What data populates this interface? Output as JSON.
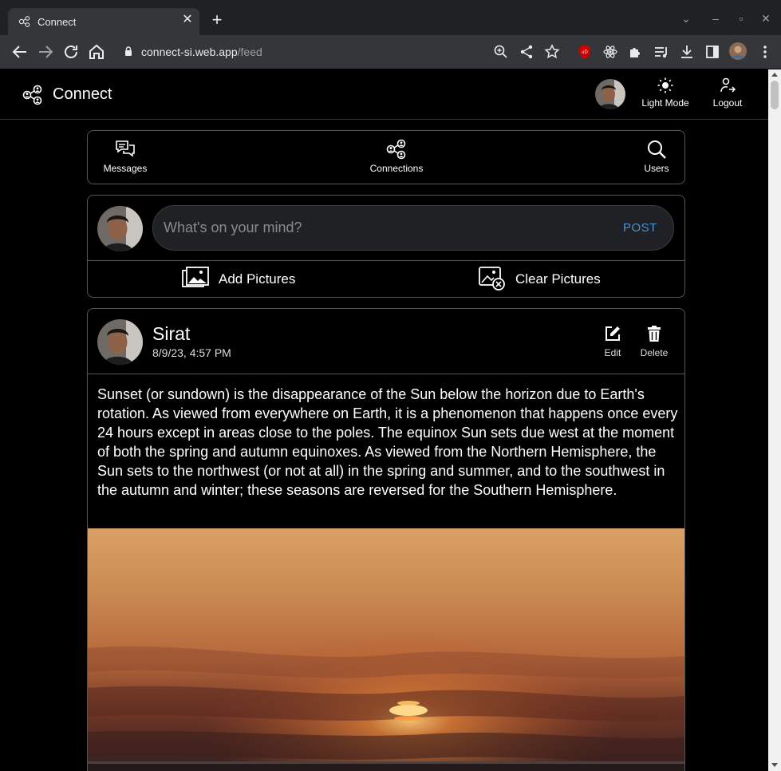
{
  "browser": {
    "tab_title": "Connect",
    "url_host": "connect-si.web.app",
    "url_path": "/feed"
  },
  "app": {
    "logo_text": "Connect",
    "header": {
      "theme_label": "Light Mode",
      "logout_label": "Logout"
    },
    "nav": [
      {
        "label": "Messages",
        "icon": "messages-icon"
      },
      {
        "label": "Connections",
        "icon": "connections-icon"
      },
      {
        "label": "Users",
        "icon": "search-icon"
      }
    ],
    "composer": {
      "placeholder": "What's on your mind?",
      "value": "",
      "post_label": "POST",
      "add_pictures_label": "Add Pictures",
      "clear_pictures_label": "Clear Pictures"
    },
    "post": {
      "author": "Sirat",
      "timestamp": "8/9/23, 4:57 PM",
      "edit_label": "Edit",
      "delete_label": "Delete",
      "text": "Sunset (or sundown) is the disappearance of the Sun below the horizon due to Earth's rotation. As viewed from everywhere on Earth, it is a phenomenon that happens once every 24 hours except in areas close to the poles. The equinox Sun sets due west at the moment of both the spring and autumn equinoxes. As viewed from the Northern Hemisphere, the Sun sets to the northwest (or not at all) in the spring and summer, and to the southwest in the autumn and winter; these seasons are reversed for the Southern Hemisphere."
    },
    "colors": {
      "background": "#000000",
      "accent": "#4a90d9",
      "border": "#555555"
    }
  }
}
